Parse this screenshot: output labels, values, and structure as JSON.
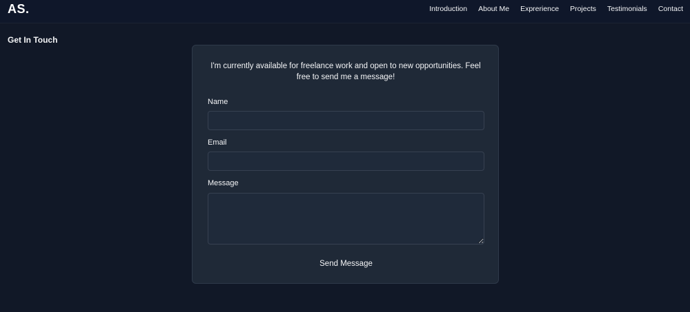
{
  "header": {
    "logo": "AS.",
    "nav": [
      "Introduction",
      "About Me",
      "Exprerience",
      "Projects",
      "Testimonials",
      "Contact"
    ]
  },
  "contact": {
    "section_title": "Get In Touch",
    "intro": "I'm currently available for freelance work and open to new opportunities. Feel free to send me a message!",
    "name_label": "Name",
    "name_value": "",
    "email_label": "Email",
    "email_value": "",
    "message_label": "Message",
    "message_value": "",
    "submit_label": "Send Message"
  },
  "colors": {
    "page_bg": "#111827",
    "header_bg": "#0f172a",
    "card_bg": "#1f2937",
    "input_bg": "#1f2a3a",
    "border": "#374151",
    "text": "#f3f4f6"
  }
}
